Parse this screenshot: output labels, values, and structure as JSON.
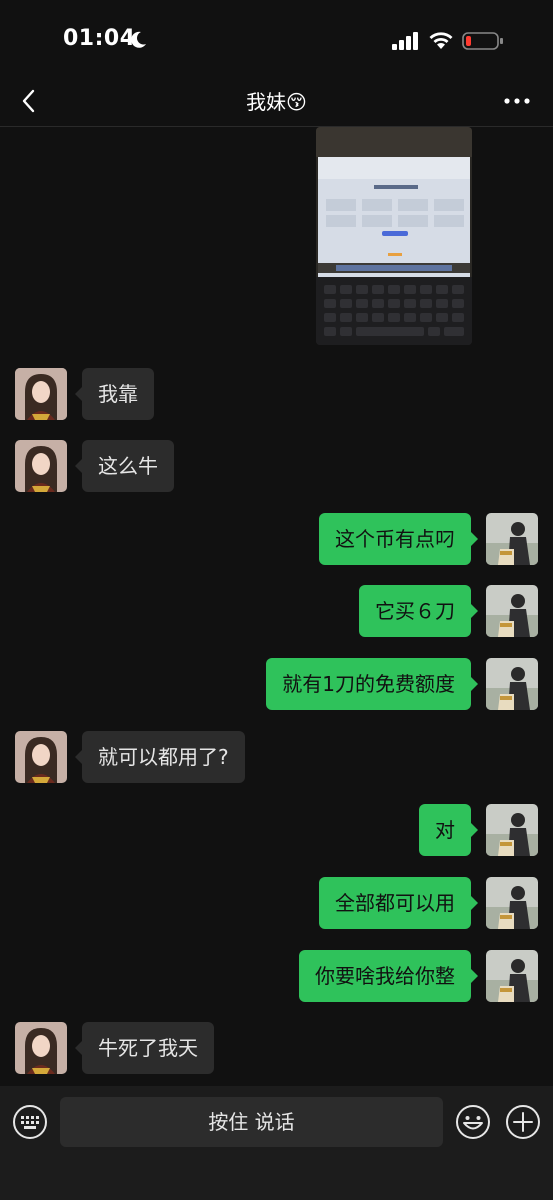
{
  "status_bar": {
    "time": "01:04",
    "icons": [
      "moon-icon",
      "signal-icon",
      "wifi-icon",
      "battery-low-icon"
    ],
    "battery_color": "#ff3b30"
  },
  "nav": {
    "title": "我妹😚",
    "back_icon": "chevron-left-icon",
    "more_icon": "more-dots-icon"
  },
  "messages": [
    {
      "from": "me",
      "type": "image",
      "content": "laptop screen photo"
    },
    {
      "from": "them",
      "type": "text",
      "text": "我靠"
    },
    {
      "from": "them",
      "type": "text",
      "text": "这么牛"
    },
    {
      "from": "me",
      "type": "text",
      "text": "这个币有点叼"
    },
    {
      "from": "me",
      "type": "text",
      "text": "它买６刀"
    },
    {
      "from": "me",
      "type": "text",
      "text": "就有1刀的免费额度"
    },
    {
      "from": "them",
      "type": "text",
      "text": "就可以都用了?"
    },
    {
      "from": "me",
      "type": "text",
      "text": "对"
    },
    {
      "from": "me",
      "type": "text",
      "text": "全部都可以用"
    },
    {
      "from": "me",
      "type": "text",
      "text": "你要啥我给你整"
    },
    {
      "from": "them",
      "type": "text",
      "text": "牛死了我天"
    }
  ],
  "input_bar": {
    "hold_to_talk": "按住 说话",
    "icons": [
      "keyboard-icon",
      "emoji-icon",
      "plus-icon"
    ]
  },
  "colors": {
    "background": "#111111",
    "bubble_me": "#2fc25b",
    "bubble_them": "#2c2c2c"
  }
}
